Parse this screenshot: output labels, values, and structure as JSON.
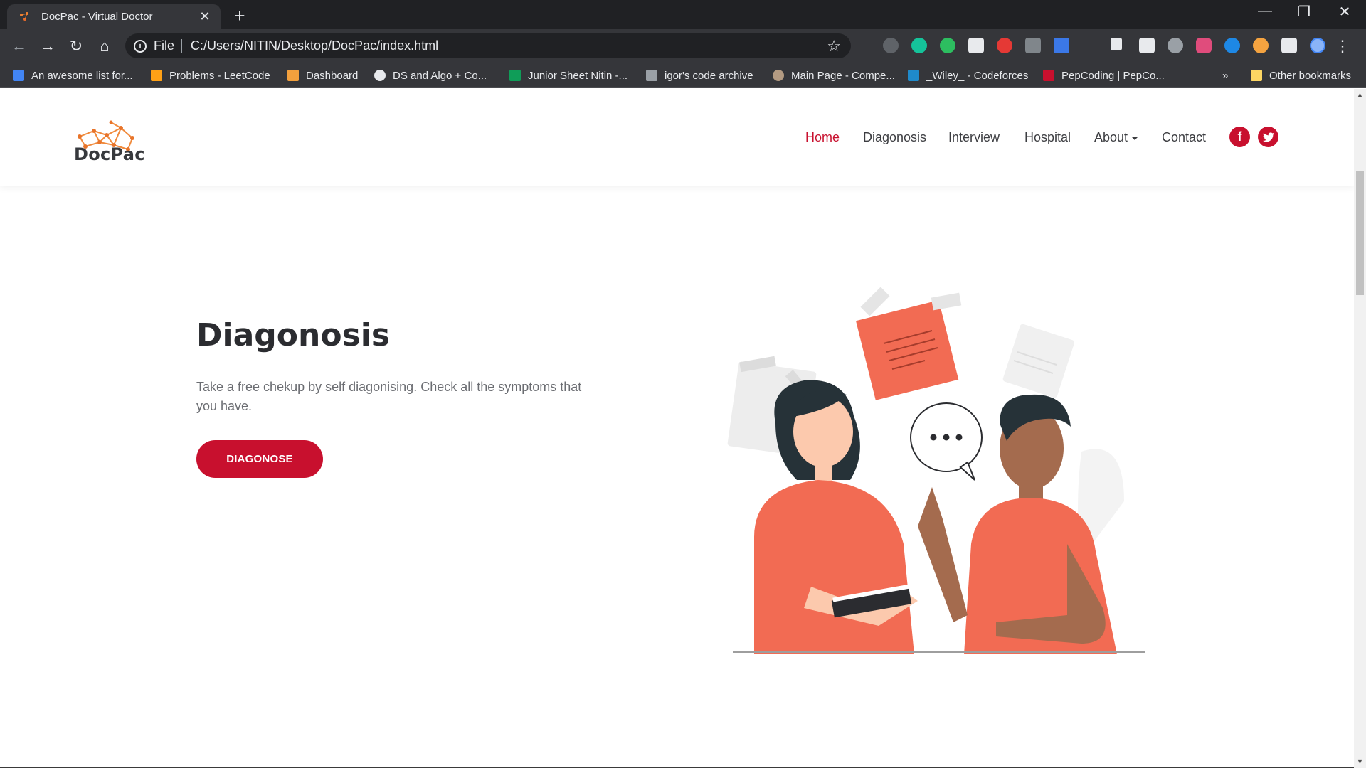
{
  "browser": {
    "tab_title": "DocPac - Virtual Doctor",
    "tab_close": "✕",
    "new_tab": "+",
    "window_controls": [
      "—",
      "❐",
      "✕"
    ],
    "back": "←",
    "forward": "→",
    "reload": "↻",
    "home": "⌂",
    "info": "i",
    "file_label": "File",
    "url": "C:/Users/NITIN/Desktop/DocPac/index.html",
    "star": "☆",
    "more": "⋮",
    "bookmarks_more": "»",
    "bookmarks": [
      {
        "label": "An awesome list for...",
        "icon_color": "#4285f4"
      },
      {
        "label": "Problems - LeetCode",
        "icon_color": "#ffa116"
      },
      {
        "label": "Dashboard",
        "icon_color": "#f2a03d"
      },
      {
        "label": "DS and Algo + Co...",
        "icon_color": "#e8eaed"
      },
      {
        "label": "Junior Sheet Nitin -...",
        "icon_color": "#0f9d58"
      },
      {
        "label": "igor's code archive",
        "icon_color": "#9aa0a6"
      },
      {
        "label": "Main Page - Compe...",
        "icon_color": "#b39b82"
      },
      {
        "label": "_Wiley_ - Codeforces",
        "icon_color": "#1f8acb"
      },
      {
        "label": "PepCoding | PepCo...",
        "icon_color": "#c8102e"
      }
    ],
    "other_bookmarks": "Other bookmarks"
  },
  "site": {
    "logo_text": "DocPac",
    "nav": [
      {
        "label": "Home",
        "active": true
      },
      {
        "label": "Diagonosis",
        "active": false
      },
      {
        "label": "Interview",
        "active": false
      },
      {
        "label": "Hospital",
        "active": false
      },
      {
        "label": "About",
        "active": false,
        "dropdown": true
      },
      {
        "label": "Contact",
        "active": false
      }
    ],
    "social": {
      "facebook": "f",
      "twitter": "t"
    },
    "hero": {
      "title": "Diagonosis",
      "text": "Take a free chekup by self diagonising. Check all the symptoms that you have.",
      "button": "DIAGONOSE",
      "speech_bubble": "• • •"
    },
    "accent_color": "#c8102e"
  }
}
